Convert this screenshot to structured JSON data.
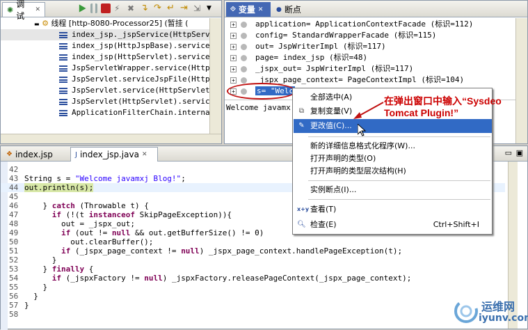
{
  "debug_panel": {
    "tab_label": "调试",
    "thread_label": "线程 [http-8080-Processor25] (暂挂 (",
    "frames": [
      "index_jsp._jspService(HttpServlet",
      "index_jsp(HttpJspBase).service(Ht",
      "index_jsp(HttpServlet).service(Se",
      "JspServletWrapper.service(HttpSer",
      "JspServlet.serviceJspFile(HttpSer",
      "JspServlet.service(HttpServletReq",
      "JspServlet(HttpServlet).service(S",
      "ApplicationFilterChain.internalDo"
    ]
  },
  "vars_panel": {
    "tabs": [
      "变量",
      "断点"
    ],
    "rows": [
      "application= ApplicationContextFacade  (标识=112)",
      "config= StandardWrapperFacade  (标识=115)",
      "out= JspWriterImpl  (标识=117)",
      "page= index_jsp  (标识=48)",
      "_jspx_out= JspWriterImpl  (标识=117)",
      "_jspx_page_context= PageContextImpl  (标识=104)",
      "s= \"Welc"
    ],
    "detail_text": "Welcome javamx"
  },
  "editor": {
    "tabs": [
      "index.jsp",
      "index_jsp.java"
    ],
    "lines": [
      {
        "n": "42",
        "code": ""
      },
      {
        "n": "43",
        "code": "String s = \"Welcome javamxj Blog!\";"
      },
      {
        "n": "44",
        "code": "out.println(s);"
      },
      {
        "n": "45",
        "code": ""
      },
      {
        "n": "46",
        "code": "    } catch (Throwable t) {"
      },
      {
        "n": "47",
        "code": "      if (!(t instanceof SkipPageException)){"
      },
      {
        "n": "48",
        "code": "        out = _jspx_out;"
      },
      {
        "n": "49",
        "code": "        if (out != null && out.getBufferSize() != 0)"
      },
      {
        "n": "50",
        "code": "          out.clearBuffer();"
      },
      {
        "n": "51",
        "code": "        if (_jspx_page_context != null) _jspx_page_context.handlePageException(t);"
      },
      {
        "n": "52",
        "code": "      }"
      },
      {
        "n": "53",
        "code": "    } finally {"
      },
      {
        "n": "54",
        "code": "      if (_jspxFactory != null) _jspxFactory.releasePageContext(_jspx_page_context);"
      },
      {
        "n": "55",
        "code": "    }"
      },
      {
        "n": "56",
        "code": "  }"
      },
      {
        "n": "57",
        "code": "}"
      },
      {
        "n": "58",
        "code": ""
      }
    ]
  },
  "context_menu": {
    "items": [
      {
        "label": "全部选中(A)",
        "icon": "",
        "shortcut": ""
      },
      {
        "label": "复制变量(V)",
        "icon": "copy-icon",
        "shortcut": ""
      },
      {
        "label": "更改值(C)...",
        "icon": "edit-icon",
        "shortcut": ""
      },
      {
        "label": "新的详细信息格式化程序(W)...",
        "icon": "",
        "shortcut": ""
      },
      {
        "label": "打开声明的类型(O)",
        "icon": "",
        "shortcut": ""
      },
      {
        "label": "打开声明的类型层次结构(H)",
        "icon": "",
        "shortcut": ""
      },
      {
        "label": "实例断点(I)...",
        "icon": "",
        "shortcut": ""
      },
      {
        "label": "查看(T)",
        "icon": "xy-icon",
        "shortcut": ""
      },
      {
        "label": "检查(E)",
        "icon": "magnifier-icon",
        "shortcut": "Ctrl+Shift+I"
      }
    ]
  },
  "annotation": {
    "line1": "在弹出窗口中输入“Sysdeo",
    "line2": "Tomcat Plugin!”"
  },
  "watermark": {
    "name": "运维网",
    "domain": "iyunv.com"
  }
}
